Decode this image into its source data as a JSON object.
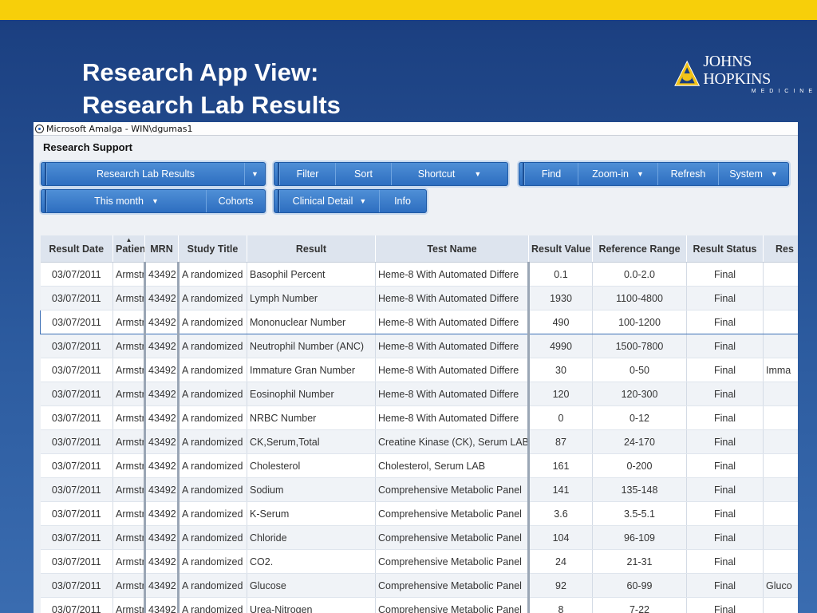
{
  "slide": {
    "title_line1": "Research App View:",
    "title_line2": "Research Lab Results",
    "logo_name": "JOHNS HOPKINS",
    "logo_sub": "MEDICINE",
    "colors": {
      "topbar": "#f7cf0a",
      "background": "#1f4a8a",
      "toolbar": "#2d6ec0"
    }
  },
  "window": {
    "title": "Microsoft Amalga - WIN\\dgumas1",
    "section": "Research Support"
  },
  "toolbar": {
    "view_select": "Research Lab Results",
    "date_select": "This month",
    "cohorts": "Cohorts",
    "filter": "Filter",
    "sort": "Sort",
    "shortcut": "Shortcut",
    "clinical_detail": "Clinical Detail",
    "info": "Info",
    "find": "Find",
    "zoom_in": "Zoom-in",
    "refresh": "Refresh",
    "system": "System"
  },
  "table": {
    "columns": [
      "Result Date",
      "Patien",
      "MRN",
      "Study Title",
      "Result",
      "Test Name",
      "Result Value",
      "Reference Range",
      "Result Status",
      "Res"
    ],
    "rows": [
      [
        "03/07/2011",
        "Armstr",
        "43492",
        "A randomized",
        "Basophil Percent",
        "Heme-8 With Automated Differe",
        "0.1",
        "0.0-2.0",
        "Final",
        ""
      ],
      [
        "03/07/2011",
        "Armstr",
        "43492",
        "A randomized",
        "Lymph Number",
        "Heme-8 With Automated Differe",
        "1930",
        "1100-4800",
        "Final",
        ""
      ],
      [
        "03/07/2011",
        "Armstr",
        "43492",
        "A randomized",
        "Mononuclear Number",
        "Heme-8 With Automated Differe",
        "490",
        "100-1200",
        "Final",
        ""
      ],
      [
        "03/07/2011",
        "Armstr",
        "43492",
        "A randomized",
        "Neutrophil Number (ANC)",
        "Heme-8 With Automated Differe",
        "4990",
        "1500-7800",
        "Final",
        ""
      ],
      [
        "03/07/2011",
        "Armstr",
        "43492",
        "A randomized",
        "Immature Gran Number",
        "Heme-8 With Automated Differe",
        "30",
        "0-50",
        "Final",
        "Imma"
      ],
      [
        "03/07/2011",
        "Armstr",
        "43492",
        "A randomized",
        "Eosinophil Number",
        "Heme-8 With Automated Differe",
        "120",
        "120-300",
        "Final",
        ""
      ],
      [
        "03/07/2011",
        "Armstr",
        "43492",
        "A randomized",
        "NRBC Number",
        "Heme-8 With Automated Differe",
        "0",
        "0-12",
        "Final",
        ""
      ],
      [
        "03/07/2011",
        "Armstr",
        "43492",
        "A randomized",
        "CK,Serum,Total",
        "Creatine Kinase (CK), Serum LAB",
        "87",
        "24-170",
        "Final",
        ""
      ],
      [
        "03/07/2011",
        "Armstr",
        "43492",
        "A randomized",
        "Cholesterol",
        "Cholesterol, Serum LAB",
        "161",
        "0-200",
        "Final",
        ""
      ],
      [
        "03/07/2011",
        "Armstr",
        "43492",
        "A randomized",
        "Sodium",
        "Comprehensive Metabolic Panel",
        "141",
        "135-148",
        "Final",
        ""
      ],
      [
        "03/07/2011",
        "Armstr",
        "43492",
        "A randomized",
        "K-Serum",
        "Comprehensive Metabolic Panel",
        "3.6",
        "3.5-5.1",
        "Final",
        ""
      ],
      [
        "03/07/2011",
        "Armstr",
        "43492",
        "A randomized",
        "Chloride",
        "Comprehensive Metabolic Panel",
        "104",
        "96-109",
        "Final",
        ""
      ],
      [
        "03/07/2011",
        "Armstr",
        "43492",
        "A randomized",
        "CO2.",
        "Comprehensive Metabolic Panel",
        "24",
        "21-31",
        "Final",
        ""
      ],
      [
        "03/07/2011",
        "Armstr",
        "43492",
        "A randomized",
        "Glucose",
        "Comprehensive Metabolic Panel",
        "92",
        "60-99",
        "Final",
        "Gluco"
      ],
      [
        "03/07/2011",
        "Armstr",
        "43492",
        "A randomized",
        "Urea-Nitrogen",
        "Comprehensive Metabolic Panel",
        "8",
        "7-22",
        "Final",
        ""
      ]
    ]
  }
}
